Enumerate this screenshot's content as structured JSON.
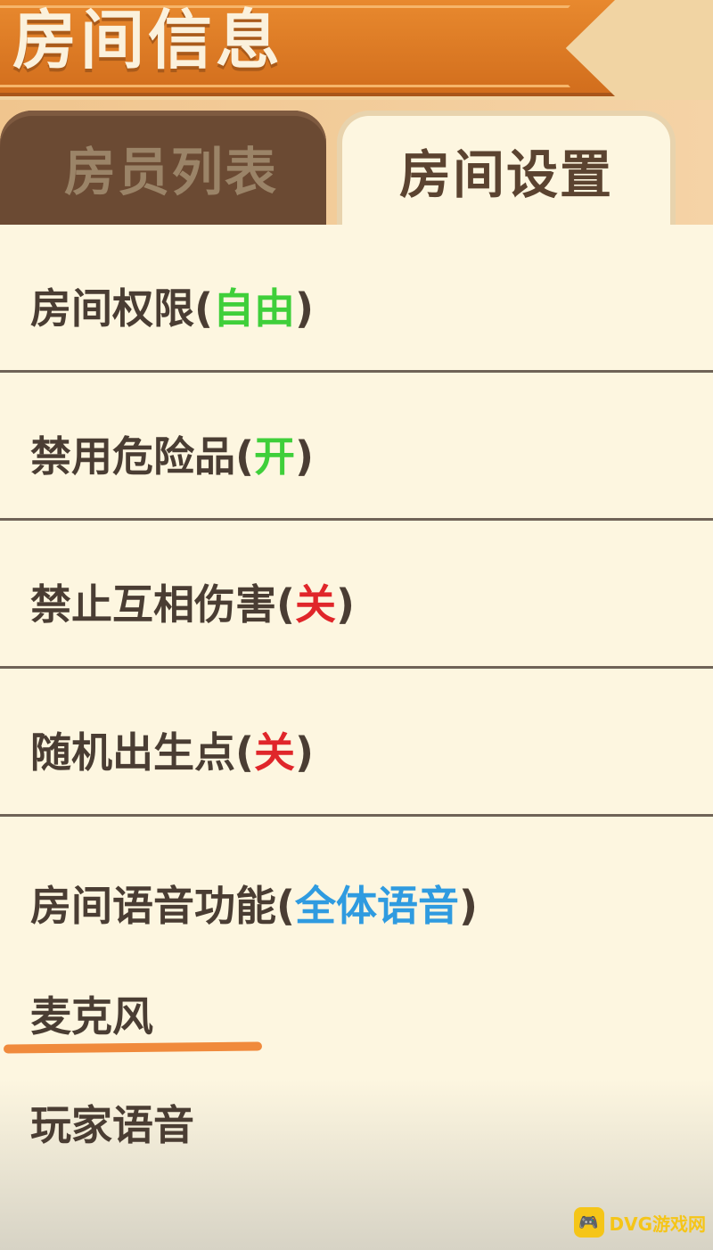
{
  "header": {
    "title": "房间信息"
  },
  "tabs": [
    {
      "label": "房员列表",
      "active": false
    },
    {
      "label": "房间设置",
      "active": true
    }
  ],
  "settings": [
    {
      "label": "房间权限(",
      "value": "自由",
      "close": ")",
      "color": "green"
    },
    {
      "label": "禁用危险品(",
      "value": "开",
      "close": ")",
      "color": "green"
    },
    {
      "label": "禁止互相伤害(",
      "value": "关",
      "close": ")",
      "color": "red"
    },
    {
      "label": "随机出生点(",
      "value": "关",
      "close": ")",
      "color": "red"
    },
    {
      "label": "房间语音功能(",
      "value": "全体语音",
      "close": ")",
      "color": "blue"
    }
  ],
  "voice": {
    "microphone": "麦克风",
    "player_voice": "玩家语音"
  },
  "watermark": {
    "text": "DVG游戏网"
  },
  "colors": {
    "accent": "#e8892e",
    "green": "#3fcf3a",
    "red": "#e0262a",
    "blue": "#2f9be0",
    "highlight": "#f08a3c"
  }
}
